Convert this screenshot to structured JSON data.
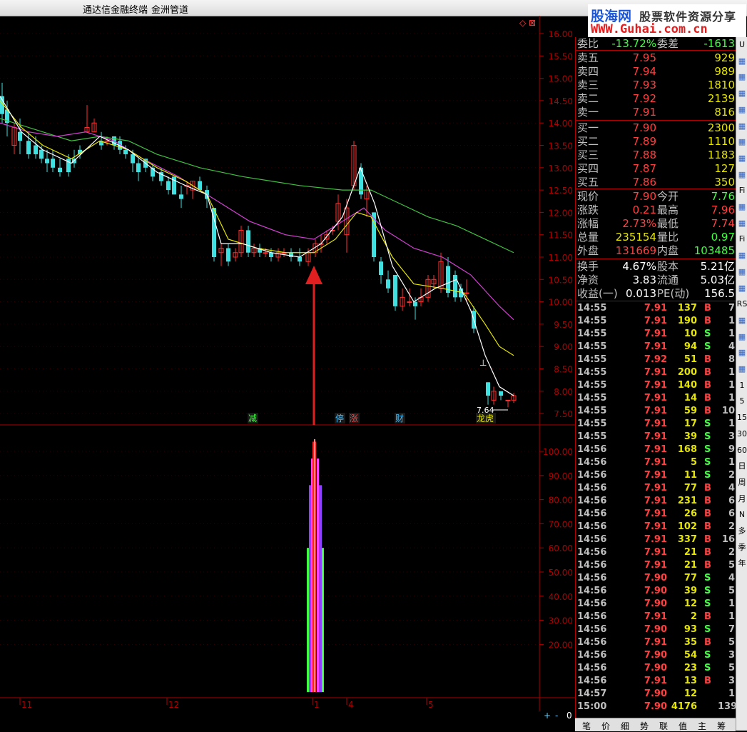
{
  "titlebar": {
    "app": "通达信金融终端",
    "menu": "金洲管道"
  },
  "logo": {
    "line1": "股海网",
    "line1b": "股票软件资源分享",
    "line2": "WWW.Guhai.com.cn"
  },
  "price_axis": [
    "16.00",
    "15.50",
    "15.00",
    "14.50",
    "14.00",
    "13.50",
    "13.00",
    "12.50",
    "12.00",
    "11.50",
    "11.00",
    "10.50",
    "10.00",
    "9.50",
    "9.00",
    "8.50",
    "8.00",
    "7.50"
  ],
  "indicator_axis": [
    "100.00",
    "90.00",
    "80.00",
    "70.00",
    "60.00",
    "50.00",
    "40.00",
    "30.00",
    "20.00"
  ],
  "date_labels": [
    {
      "text": "11"
    },
    {
      "text": "12"
    },
    {
      "text": "1"
    },
    {
      "text": "4"
    },
    {
      "text": "5"
    }
  ],
  "markers": [
    {
      "text": "减",
      "color": "#40ff40"
    },
    {
      "text": "停",
      "color": "#40c0ff"
    },
    {
      "text": "涨",
      "color": "#ff4040"
    },
    {
      "text": "财",
      "color": "#40c0ff"
    },
    {
      "text": "龙虎",
      "color": "#e6e600"
    }
  ],
  "low_label": "7.64",
  "quote": {
    "weibi": {
      "label": "委比",
      "value": "-13.72%",
      "label2": "委差",
      "value2": "-1613"
    },
    "asks": [
      {
        "label": "卖五",
        "price": "7.95",
        "vol": "929"
      },
      {
        "label": "卖四",
        "price": "7.94",
        "vol": "989"
      },
      {
        "label": "卖三",
        "price": "7.93",
        "vol": "1810"
      },
      {
        "label": "卖二",
        "price": "7.92",
        "vol": "2139"
      },
      {
        "label": "卖一",
        "price": "7.91",
        "vol": "816"
      }
    ],
    "bids": [
      {
        "label": "买一",
        "price": "7.90",
        "vol": "2300"
      },
      {
        "label": "买二",
        "price": "7.89",
        "vol": "1110"
      },
      {
        "label": "买三",
        "price": "7.88",
        "vol": "1183"
      },
      {
        "label": "买四",
        "price": "7.87",
        "vol": "127"
      },
      {
        "label": "买五",
        "price": "7.86",
        "vol": "350"
      }
    ],
    "stats": [
      {
        "l1": "现价",
        "v1": "7.90",
        "c1": "red",
        "l2": "今开",
        "v2": "7.76",
        "c2": "green"
      },
      {
        "l1": "涨跌",
        "v1": "0.21",
        "c1": "red",
        "l2": "最高",
        "v2": "7.96",
        "c2": "red"
      },
      {
        "l1": "涨幅",
        "v1": "2.73%",
        "c1": "red",
        "l2": "最低",
        "v2": "7.74",
        "c2": "red"
      },
      {
        "l1": "总量",
        "v1": "235154",
        "c1": "yellow",
        "l2": "量比",
        "v2": "0.97",
        "c2": "green"
      },
      {
        "l1": "外盘",
        "v1": "131669",
        "c1": "red",
        "l2": "内盘",
        "v2": "103485",
        "c2": "green"
      }
    ],
    "stats2": [
      {
        "l1": "换手",
        "v1": "4.67%",
        "l2": "股本",
        "v2": "5.21亿"
      },
      {
        "l1": "净资",
        "v1": "3.83",
        "l2": "流通",
        "v2": "5.03亿"
      },
      {
        "l1": "收益(一)",
        "v1": "0.013",
        "l2": "PE(动)",
        "v2": "156.5"
      }
    ],
    "ticks": [
      {
        "t": "14:55",
        "p": "7.91",
        "v": "137",
        "bs": "B",
        "n": "7"
      },
      {
        "t": "14:55",
        "p": "7.91",
        "v": "190",
        "bs": "B",
        "n": "1"
      },
      {
        "t": "14:55",
        "p": "7.91",
        "v": "10",
        "bs": "S",
        "n": "1"
      },
      {
        "t": "14:55",
        "p": "7.91",
        "v": "94",
        "bs": "S",
        "n": "4"
      },
      {
        "t": "14:55",
        "p": "7.92",
        "v": "51",
        "bs": "B",
        "n": "8"
      },
      {
        "t": "14:55",
        "p": "7.91",
        "v": "200",
        "bs": "B",
        "n": "1"
      },
      {
        "t": "14:55",
        "p": "7.91",
        "v": "140",
        "bs": "B",
        "n": "1"
      },
      {
        "t": "14:55",
        "p": "7.91",
        "v": "14",
        "bs": "B",
        "n": "1"
      },
      {
        "t": "14:55",
        "p": "7.91",
        "v": "59",
        "bs": "B",
        "n": "10"
      },
      {
        "t": "14:55",
        "p": "7.91",
        "v": "17",
        "bs": "S",
        "n": "1"
      },
      {
        "t": "14:55",
        "p": "7.91",
        "v": "39",
        "bs": "S",
        "n": "3"
      },
      {
        "t": "14:56",
        "p": "7.91",
        "v": "168",
        "bs": "S",
        "n": "9"
      },
      {
        "t": "14:56",
        "p": "7.91",
        "v": "5",
        "bs": "S",
        "n": "1"
      },
      {
        "t": "14:56",
        "p": "7.91",
        "v": "11",
        "bs": "S",
        "n": "2"
      },
      {
        "t": "14:56",
        "p": "7.91",
        "v": "77",
        "bs": "B",
        "n": "4"
      },
      {
        "t": "14:56",
        "p": "7.91",
        "v": "231",
        "bs": "B",
        "n": "6"
      },
      {
        "t": "14:56",
        "p": "7.91",
        "v": "26",
        "bs": "B",
        "n": "6"
      },
      {
        "t": "14:56",
        "p": "7.91",
        "v": "102",
        "bs": "B",
        "n": "2"
      },
      {
        "t": "14:56",
        "p": "7.91",
        "v": "337",
        "bs": "B",
        "n": "16"
      },
      {
        "t": "14:56",
        "p": "7.91",
        "v": "21",
        "bs": "B",
        "n": "2"
      },
      {
        "t": "14:56",
        "p": "7.91",
        "v": "21",
        "bs": "B",
        "n": "5"
      },
      {
        "t": "14:56",
        "p": "7.90",
        "v": "77",
        "bs": "S",
        "n": "4"
      },
      {
        "t": "14:56",
        "p": "7.90",
        "v": "39",
        "bs": "S",
        "n": "5"
      },
      {
        "t": "14:56",
        "p": "7.90",
        "v": "12",
        "bs": "S",
        "n": "1"
      },
      {
        "t": "14:56",
        "p": "7.91",
        "v": "2",
        "bs": "B",
        "n": "1"
      },
      {
        "t": "14:56",
        "p": "7.90",
        "v": "93",
        "bs": "S",
        "n": "7"
      },
      {
        "t": "14:56",
        "p": "7.91",
        "v": "35",
        "bs": "B",
        "n": "5"
      },
      {
        "t": "14:56",
        "p": "7.90",
        "v": "54",
        "bs": "S",
        "n": "3"
      },
      {
        "t": "14:56",
        "p": "7.90",
        "v": "23",
        "bs": "S",
        "n": "5"
      },
      {
        "t": "14:56",
        "p": "7.91",
        "v": "13",
        "bs": "B",
        "n": "3"
      },
      {
        "t": "14:57",
        "p": "7.90",
        "v": "12",
        "bs": "",
        "n": "1"
      },
      {
        "t": "15:00",
        "p": "7.90",
        "v": "4176",
        "bs": "",
        "n": "139"
      }
    ]
  },
  "toolbar_items": [
    "U",
    "",
    "",
    "",
    "",
    "",
    "",
    "",
    "",
    "Fi",
    "",
    "",
    "Fi",
    "",
    "",
    "",
    "RS",
    "",
    "",
    "",
    "",
    "1",
    "5",
    "15",
    "30",
    "60",
    "日",
    "周",
    "月",
    "N",
    "多",
    "季",
    "年"
  ],
  "bottom_tabs": [
    "笔",
    "价",
    "细",
    "势",
    "联",
    "值",
    "主",
    "筹"
  ],
  "zoom_controls": [
    "+",
    "-",
    "0"
  ]
}
